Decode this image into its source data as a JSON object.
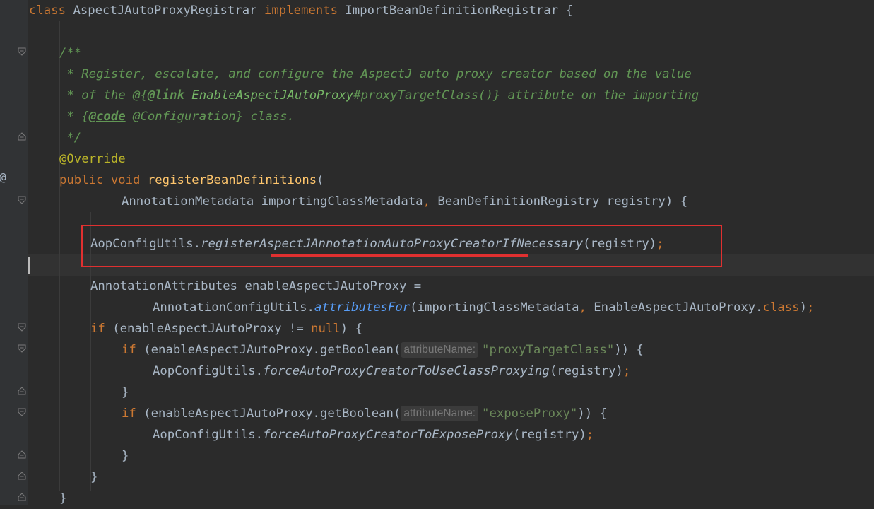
{
  "code": {
    "class_kw": "class",
    "class_name": "AspectJAutoProxyRegistrar",
    "implements_kw": "implements",
    "interface_name": "ImportBeanDefinitionRegistrar",
    "open_brace": "{",
    "doc_open": "/**",
    "doc_line1": " * Register, escalate, and configure the AspectJ auto proxy creator based on the value",
    "doc_line2_pre": " * of the @{",
    "doc_link_tag": "@link",
    "doc_line2_ref": " EnableAspectJAutoProxy",
    "doc_line2_post": "#proxyTargetClass()} attribute on the importing",
    "doc_line3_pre": " * {",
    "doc_code_tag": "@code",
    "doc_line3_post": " @Configuration} class.",
    "doc_close": " */",
    "annotation": "@Override",
    "public_kw": "public",
    "void_kw": "void",
    "method_name": "registerBeanDefinitions",
    "paren_open": "(",
    "param1": "AnnotationMetadata importingClassMetadata",
    "comma": ",",
    "param2": " BeanDefinitionRegistry registry) {",
    "call1_class": "AopConfigUtils.",
    "call1_method": "registerAspectJAnnotationAutoProxyCreatorIfNecessary",
    "call1_args": "(registry)",
    "semicolon": ";",
    "decl_type": "AnnotationAttributes enableAspectJAutoProxy =",
    "decl_class": "AnnotationConfigUtils.",
    "decl_method": "attributesFor",
    "decl_args_pre": "(importingClassMetadata",
    "decl_args_class": " EnableAspectJAutoProxy.",
    "class_kw2": "class",
    "decl_args_post": ")",
    "if_kw": "if",
    "if1_cond_pre": " (enableAspectJAutoProxy != ",
    "null_kw": "null",
    "if1_cond_post": ") {",
    "if2_pre": " (enableAspectJAutoProxy.getBoolean(",
    "hint_label": "attributeName:",
    "str1": "\"proxyTargetClass\"",
    "if_tail": ")) {",
    "call2_class": "AopConfigUtils.",
    "call2_method": "forceAutoProxyCreatorToUseClassProxying",
    "call2_args": "(registry)",
    "close_brace": "}",
    "str2": "\"exposeProxy\"",
    "call3_class": "AopConfigUtils.",
    "call3_method": "forceAutoProxyCreatorToExposeProxy",
    "call3_args": "(registry)"
  },
  "gutter": {
    "implements_marker": "@"
  },
  "colors": {
    "background": "#2b2b2b",
    "keyword": "#cc7832",
    "function": "#ffc66d",
    "doc_comment": "#629755",
    "annotation": "#bbb529",
    "string": "#6a8759",
    "link": "#589df6",
    "highlight_box": "#e03030"
  }
}
